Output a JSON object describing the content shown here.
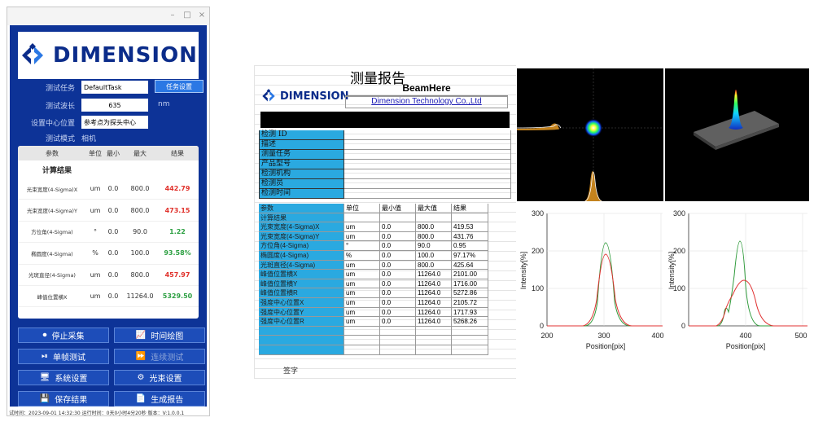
{
  "app": {
    "brand": "DIMENSION",
    "window_controls": {
      "minimize": "–",
      "maximize": "□",
      "close": "×"
    },
    "fields": {
      "task_label": "测试任务",
      "task_value": "DefaultTask",
      "task_button": "任务设置",
      "wavelength_label": "测试波长",
      "wavelength_value": "635",
      "wavelength_unit": "nm",
      "center_label": "设置中心位置",
      "center_value": "参考点为探头中心",
      "mode_label": "测试模式",
      "mode_value": "相机"
    },
    "table": {
      "headers": [
        "参数",
        "单位",
        "最小",
        "最大",
        "结果"
      ],
      "section": "计算结果",
      "rows": [
        {
          "name": "光束宽度(4-Sigma)X",
          "unit": "um",
          "min": "0.0",
          "max": "800.0",
          "result": "442.79",
          "color": "#e0302a"
        },
        {
          "name": "光束宽度(4-Sigma)Y",
          "unit": "um",
          "min": "0.0",
          "max": "800.0",
          "result": "473.15",
          "color": "#e0302a"
        },
        {
          "name": "方位角(4-Sigma)",
          "unit": "°",
          "min": "0.0",
          "max": "90.0",
          "result": "1.22",
          "color": "#2ea043"
        },
        {
          "name": "椭圆度(4-Sigma)",
          "unit": "%",
          "min": "0.0",
          "max": "100.0",
          "result": "93.58%",
          "color": "#2ea043"
        },
        {
          "name": "光斑直径(4-Sigma)",
          "unit": "um",
          "min": "0.0",
          "max": "800.0",
          "result": "457.97",
          "color": "#e0302a"
        },
        {
          "name": "峰值位置横X",
          "unit": "um",
          "min": "0.0",
          "max": "11264.0",
          "result": "5329.50",
          "color": "#2ea043"
        }
      ]
    },
    "buttons": {
      "stop_capture": "停止采集",
      "time_plot": "时间绘图",
      "single_test": "单帧测试",
      "continuous_test": "连续测试",
      "system_settings": "系统设置",
      "beam_settings": "光束设置",
      "save_results": "保存结果",
      "generate_report": "生成报告"
    },
    "status": "试时间：2023-09-01 14:32:30    运行时间：0天0小时4分20秒    版本：V:1.0.0.1"
  },
  "report": {
    "title": "测量报告",
    "brand": "DIMENSION",
    "product": "BeamHere",
    "company": "Dimension Technology Co.,Ltd",
    "info_labels": [
      "检测 ID",
      "描述",
      "测量任务",
      "产品型号",
      "检测机构",
      "检测员",
      "检测时间"
    ],
    "table_headers": [
      "参数",
      "单位",
      "最小值",
      "最大值",
      "结果"
    ],
    "section": "计算结果",
    "rows": [
      [
        "光束宽度(4-Sigma)X",
        "um",
        "0.0",
        "800.0",
        "419.53"
      ],
      [
        "光束宽度(4-Sigma)Y",
        "um",
        "0.0",
        "800.0",
        "431.76"
      ],
      [
        "方位角(4-Sigma)",
        "°",
        "0.0",
        "90.0",
        "0.95"
      ],
      [
        "椭圆度(4-Sigma)",
        "%",
        "0.0",
        "100.0",
        "97.17%"
      ],
      [
        "光斑直径(4-Sigma)",
        "um",
        "0.0",
        "800.0",
        "425.64"
      ],
      [
        "峰值位置横X",
        "um",
        "0.0",
        "11264.0",
        "2101.00"
      ],
      [
        "峰值位置横Y",
        "um",
        "0.0",
        "11264.0",
        "1716.00"
      ],
      [
        "峰值位置横R",
        "um",
        "0.0",
        "11264.0",
        "5272.86"
      ],
      [
        "强度中心位置X",
        "um",
        "0.0",
        "11264.0",
        "2105.72"
      ],
      [
        "强度中心位置Y",
        "um",
        "0.0",
        "11264.0",
        "1717.93"
      ],
      [
        "强度中心位置R",
        "um",
        "0.0",
        "11264.0",
        "5268.26"
      ]
    ],
    "sign_label": "签字",
    "plot1": {
      "ylabel": "Intensity[%]",
      "xlabel": "Position[pix]",
      "yticks": [
        "0",
        "100",
        "200",
        "300"
      ],
      "xticks": [
        "200",
        "300",
        "400"
      ]
    },
    "plot2": {
      "ylabel": "Intensity[%]",
      "xlabel": "Position[pix]",
      "yticks": [
        "0",
        "100",
        "200",
        "300"
      ],
      "xticks": [
        "400",
        "500"
      ]
    }
  }
}
